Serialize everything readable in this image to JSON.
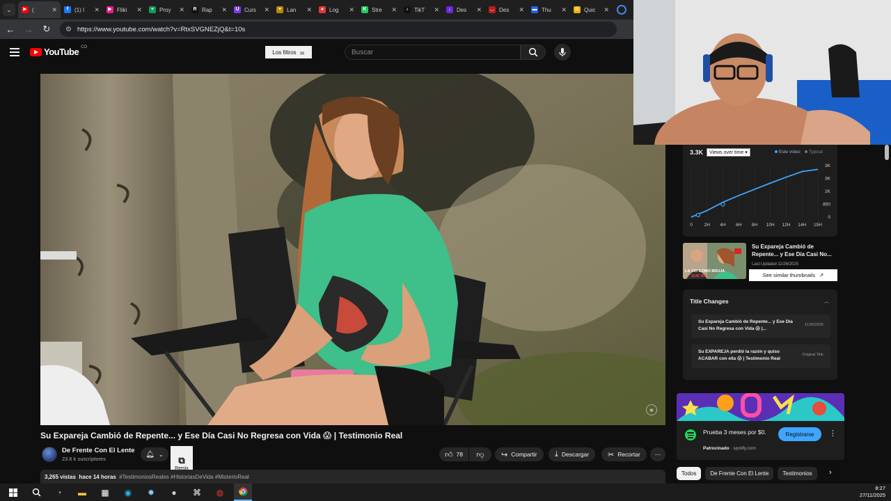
{
  "browser": {
    "tabs": [
      {
        "label": "(",
        "fav_color": "#ff0000",
        "fav_glyph": "▶",
        "active": true
      },
      {
        "label": "(1) I",
        "fav_color": "#1877f2",
        "fav_glyph": "f",
        "active": false
      },
      {
        "label": "Fliki",
        "fav_color": "#e91e8c",
        "fav_glyph": "▶",
        "active": false
      },
      {
        "label": "Proy",
        "fav_color": "#0f9d58",
        "fav_glyph": "+",
        "active": false
      },
      {
        "label": "Rap",
        "fav_color": "#111111",
        "fav_glyph": "R",
        "active": false
      },
      {
        "label": "Curs",
        "fav_color": "#7c3aed",
        "fav_glyph": "U",
        "active": false
      },
      {
        "label": "Lan",
        "fav_color": "#b8860b",
        "fav_glyph": "✦",
        "active": false
      },
      {
        "label": "Log",
        "fav_color": "#e53935",
        "fav_glyph": "●",
        "active": false
      },
      {
        "label": "Stre",
        "fav_color": "#22c55e",
        "fav_glyph": "K",
        "active": false
      },
      {
        "label": "TikT",
        "fav_color": "#111111",
        "fav_glyph": "♪",
        "active": false
      },
      {
        "label": "Des",
        "fav_color": "#6d28d9",
        "fav_glyph": "↓",
        "active": false
      },
      {
        "label": "Des",
        "fav_color": "#b91c1c",
        "fav_glyph": "◡",
        "active": false
      },
      {
        "label": "Thu",
        "fav_color": "#2563eb",
        "fav_glyph": "▬",
        "active": false
      },
      {
        "label": "Quic",
        "fav_color": "#eab308",
        "fav_glyph": "◘",
        "active": false
      }
    ],
    "url": "https://www.youtube.com/watch?v=RtxSVGNEZjQ&t=10s"
  },
  "yt_header": {
    "logo": "YouTube",
    "country": "CO",
    "filters_label": "Los filtros",
    "search_placeholder": "Buscar"
  },
  "video": {
    "title": "Su Expareja Cambió de Repente... y Ese Día Casi No Regresa con Vida 😱 | Testimonio Real",
    "channel": "De Frente Con El Lente",
    "subscribers": "23.6 k suscriptores",
    "remix_label": "Remix",
    "likes": "78",
    "share_label": "Compartir",
    "download_label": "Descargar",
    "clip_label": "Recortar",
    "views": "3,265 vistas",
    "age": "hace 14 horas",
    "hashtags": "#TestimoniosReales #HistoriasDeVida #MisterioReal"
  },
  "analytics": {
    "views": "3.3K",
    "mode": "Views over time",
    "legend_this": "Este vídeo",
    "legend_typical": "Typical",
    "chart_data": {
      "type": "line",
      "x": [
        "0",
        "2H",
        "4H",
        "6H",
        "8H",
        "10H",
        "12H",
        "14H",
        "15H"
      ],
      "series": [
        {
          "name": "Este vídeo",
          "values": [
            0,
            420,
            950,
            1380,
            1780,
            2180,
            2560,
            2920,
            3060
          ]
        }
      ],
      "y_ticks": [
        "3K",
        "3K",
        "2K",
        "850",
        "0"
      ],
      "ylim": [
        0,
        3300
      ]
    }
  },
  "thumbnail_card": {
    "title": "Su Expareja Cambió de Repente... y Ese Día Casi No...",
    "updated": "Last Updated 11/26/2025",
    "button": "See similar thumbnails",
    "thumb_text": "LA VIO COMO BRUJA QUE NO"
  },
  "title_changes": {
    "header": "Title Changes",
    "items": [
      {
        "title": "Su Expareja Cambió de Repente... y Ese Día Casi No Regresa con Vida 😱 |...",
        "meta": "11/26/2025"
      },
      {
        "title": "Su EXPAREJA perdió la razón y quiso ACABAR con ella 😱 | Testimonio Real",
        "meta": "Original Title"
      }
    ]
  },
  "ad": {
    "text": "Prueba 3 meses por $0.",
    "sponsored": "Patrocinado",
    "domain": "spotify.com",
    "cta": "Registrarse"
  },
  "chips": [
    "Todos",
    "De Frente Con El Lente",
    "Testimonios"
  ],
  "taskbar": {
    "time": "8:27",
    "date": "27/11/2025"
  }
}
